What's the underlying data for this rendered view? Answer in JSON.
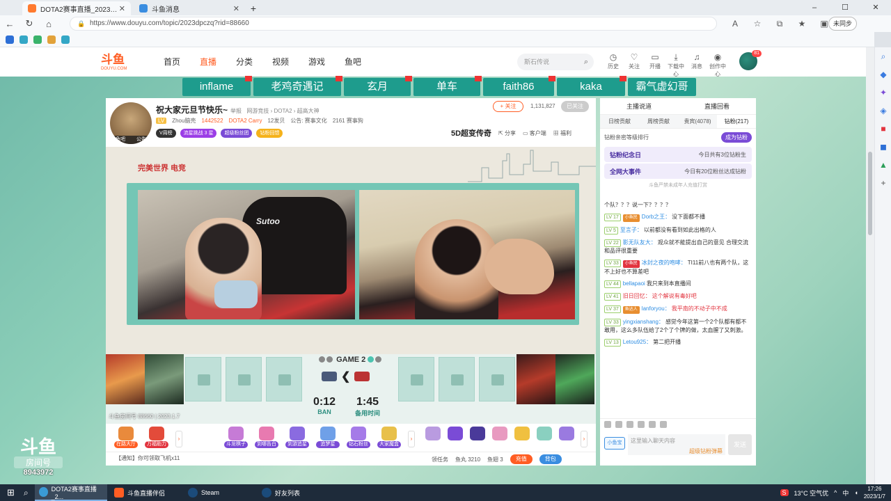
{
  "browser": {
    "tabs": [
      {
        "title": "DOTA2赛事直播_2023DPC东",
        "active": true
      },
      {
        "title": "斗鱼消息",
        "active": false
      }
    ],
    "url": "https://www.douyu.com/topic/2023dpczq?rid=88660",
    "profile_label": "未同步",
    "window_buttons": [
      "–",
      "☐",
      "✕"
    ]
  },
  "site": {
    "logo_main": "斗鱼",
    "logo_sub": "DOUYU.COM",
    "nav": [
      "首页",
      "直播",
      "分类",
      "视频",
      "游戏",
      "鱼吧"
    ],
    "search_placeholder": "斯石传说",
    "header_icons": [
      "历史",
      "关注",
      "开播",
      "下载中心",
      "消息",
      "创作中心"
    ],
    "avatar_badge": "81"
  },
  "team_strip": [
    "inflame",
    "老鸡奇遇记",
    "玄月",
    "单车",
    "faith86",
    "kaka",
    "霸气虚幻哥"
  ],
  "room": {
    "title": "祝大家元旦节快乐~",
    "title_sub": "举报",
    "category": "网游竞技 › DOTA2 › 超高大神",
    "streamer": "Zhou脑壳",
    "heat": "1442522",
    "rank_tag": "DOTA2 Carry",
    "fans_group": "12发贝",
    "announcement": "公告: 赛事文化",
    "followers_text": "2161 赛事狗",
    "badges": [
      "V周榜",
      "流星挑战 3 星",
      "超级粉丝团",
      "钻粉回馈"
    ],
    "follow_label": "+ 关注",
    "follow_count": "1,131,827",
    "report_label": "已关注",
    "brand_label": "5D超变传奇",
    "share_label": "分享",
    "client_label": "客户端",
    "welfare_label": "福利",
    "avatar_tags": [
      "鱼吧",
      "公告"
    ]
  },
  "video": {
    "sponsor_logo": "完美世界 电竞",
    "chair_brand": "Sutoo",
    "game_label": "GAME 2",
    "ban_time": "0:12",
    "ban_label": "BAN",
    "reserve_time": "1:45",
    "reserve_label": "备用时间",
    "watermark": "斗鱼房间号 88660 | 2023.1.7"
  },
  "gifts": [
    "在路大厅",
    "万福助力",
    "斗龙棋子",
    "到哪告白",
    "到游追星",
    "追梦星",
    "钻石粉丝",
    "大家魔盒"
  ],
  "bottombar": {
    "ticker": "【通知】你可领取飞机x11",
    "task_label": "领任务",
    "fish_ball": "鱼丸 3210",
    "fish_fin": "鱼翅 3",
    "recharge_label": "充值",
    "bag_label": "背包"
  },
  "chat": {
    "top_links": [
      "主播说道",
      "直播回看"
    ],
    "tabs": [
      "日榜贡献",
      "周榜贡献",
      "贵宾(4078)",
      "钻粉(217)"
    ],
    "rank_label": "钻粉亲密等级排行",
    "become_label": "成为钻粉",
    "notices": [
      {
        "title": "钻粉纪念日",
        "text": "今日共有3位钻粉生"
      },
      {
        "title": "全网大事件",
        "text": "今日有20位粉丝达成钻粉"
      }
    ],
    "system_msg": "斗鱼严禁未成年人充值打赏",
    "messages": [
      {
        "lvl": "",
        "fan": "",
        "nick": "",
        "text": "个队？？？说一下？？？？",
        "color": ""
      },
      {
        "lvl": "LV 17",
        "fan": "小鱼民",
        "nick": "Dorb之王：",
        "text": "没下面都不播",
        "color": ""
      },
      {
        "lvl": "LV 5",
        "fan": "",
        "nick": "至言子：",
        "text": "以前都没有看到如此出格的人",
        "color": ""
      },
      {
        "lvl": "LV 22",
        "fan": "",
        "nick": "影无队友大：",
        "text": "观众就不能提出自己的意见 合理交流和品评很重要",
        "color": ""
      },
      {
        "lvl": "LV 33",
        "fan": "小鱼民",
        "nick": "冰封之夜的咆哮：",
        "text": "TI11前八也有两个队，这不上好也不算差吧",
        "color": ""
      },
      {
        "lvl": "LV 44",
        "fan": "",
        "nick": "bellapaoi",
        "text": "我只来到本直播间",
        "color": ""
      },
      {
        "lvl": "LV 41",
        "fan": "",
        "nick": "旧日回忆：",
        "text": "这个解说有毒好吧",
        "color": "red"
      },
      {
        "lvl": "LV 37",
        "fan": "鱼达人",
        "nick": "lanforyou：",
        "text": "我平南的不动子中不成",
        "color": "red"
      },
      {
        "lvl": "LV 33",
        "fan": "",
        "nick": "yingxianshang：",
        "text": "感觉今年这第一个2个队都有都不敢用，这么多队伍给了2个了个牌的做，太血腥了又刺激。",
        "color": ""
      },
      {
        "lvl": "LV 13",
        "fan": "",
        "nick": "Letou925：",
        "text": "第二把开播",
        "color": ""
      }
    ],
    "input_placeholder": "这里输入聊天内容",
    "send_label": "发送",
    "input_tag": "小鱼宝",
    "promo_label": "超级钻粉弹幕"
  },
  "side_room": {
    "line1": "斗鱼",
    "line2": "房间号",
    "line3": "8943972"
  },
  "taskbar": {
    "items": [
      "DOTA2赛事直播_2...",
      "斗鱼直播伴侣",
      "Steam",
      "好友列表"
    ],
    "weather": "13°C 空气优",
    "ime": "中",
    "time": "17:26",
    "date": "2023/1/7"
  }
}
